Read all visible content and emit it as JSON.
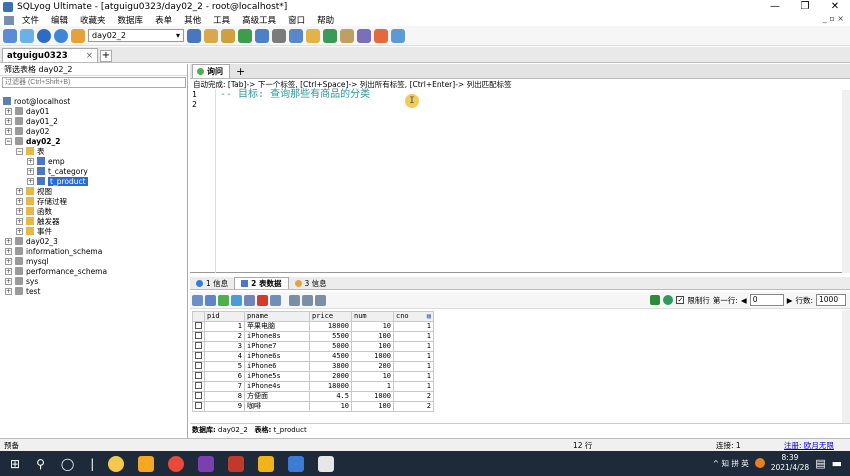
{
  "window": {
    "title": "SQLyog Ultimate - [atguigu0323/day02_2 - root@localhost*]",
    "minimize": "—",
    "restore": "❐",
    "close": "✕",
    "mdi_controls": "_ ▫ ×"
  },
  "menu": [
    "文件",
    "编辑",
    "收藏夹",
    "数据库",
    "表单",
    "其他",
    "工具",
    "高级工具",
    "窗口",
    "帮助"
  ],
  "toolbar": {
    "database_selected": "day02_2"
  },
  "connection_tab": {
    "label": "atguigu0323",
    "close": "×",
    "add": "+"
  },
  "left": {
    "filter_label": "筛选表格 day02_2",
    "filter_placeholder": "过滤器 (Ctrl+Shift+B)",
    "tree": [
      {
        "label": "root@localhost"
      },
      {
        "label": "day01"
      },
      {
        "label": "day01_2"
      },
      {
        "label": "day02"
      },
      {
        "label": "day02_2"
      },
      {
        "label": "表"
      },
      {
        "label": "emp"
      },
      {
        "label": "t_category"
      },
      {
        "label": "t_product"
      },
      {
        "label": "视图"
      },
      {
        "label": "存储过程"
      },
      {
        "label": "函数"
      },
      {
        "label": "触发器"
      },
      {
        "label": "事件"
      },
      {
        "label": "day02_3"
      },
      {
        "label": "information_schema"
      },
      {
        "label": "mysql"
      },
      {
        "label": "performance_schema"
      },
      {
        "label": "sys"
      },
      {
        "label": "test"
      }
    ]
  },
  "editor": {
    "tab_label": "询问",
    "add_tab": "+",
    "hint": "自动完成: [Tab]-> 下一个标签, [Ctrl+Space]-> 列出所有标签, [Ctrl+Enter]-> 列出匹配标签",
    "lines": [
      "1",
      "2"
    ],
    "code": [
      "-- 目标: 查询那些有商品的分类",
      ""
    ]
  },
  "results": {
    "tabs": [
      "1 信息",
      "2 表数据",
      "3 信息"
    ],
    "limit_label": "限制行",
    "first_row_label": "第一行:",
    "first_row_value": "0",
    "row_count_label": "行数:",
    "row_count_value": "1000",
    "columns": [
      "pid",
      "pname",
      "price",
      "num",
      "cno"
    ],
    "rows": [
      [
        "1",
        "苹果电脑",
        "18000",
        "10",
        "1"
      ],
      [
        "2",
        "iPhone8s",
        "5500",
        "100",
        "1"
      ],
      [
        "3",
        "iPhone7",
        "5000",
        "100",
        "1"
      ],
      [
        "4",
        "iPhone6s",
        "4500",
        "1000",
        "1"
      ],
      [
        "5",
        "iPhone6",
        "3800",
        "200",
        "1"
      ],
      [
        "6",
        "iPhone5s",
        "2000",
        "10",
        "1"
      ],
      [
        "7",
        "iPhone4s",
        "18000",
        "1",
        "1"
      ],
      [
        "8",
        "方便面",
        "4.5",
        "1000",
        "2"
      ],
      [
        "9",
        "咖啡",
        "10",
        "100",
        "2"
      ]
    ]
  },
  "db_status": {
    "db_label": "数据库:",
    "db_value": "day02_2",
    "table_label": "表格:",
    "table_value": "t_product"
  },
  "statusbar": {
    "left": "预备",
    "rows": "12 行",
    "connection": "连接: 1",
    "register": "注册: 欧月无限"
  },
  "taskbar": {
    "time": "8:39",
    "date": "2021/4/28",
    "tray_text": "^ 知 拼 英"
  }
}
